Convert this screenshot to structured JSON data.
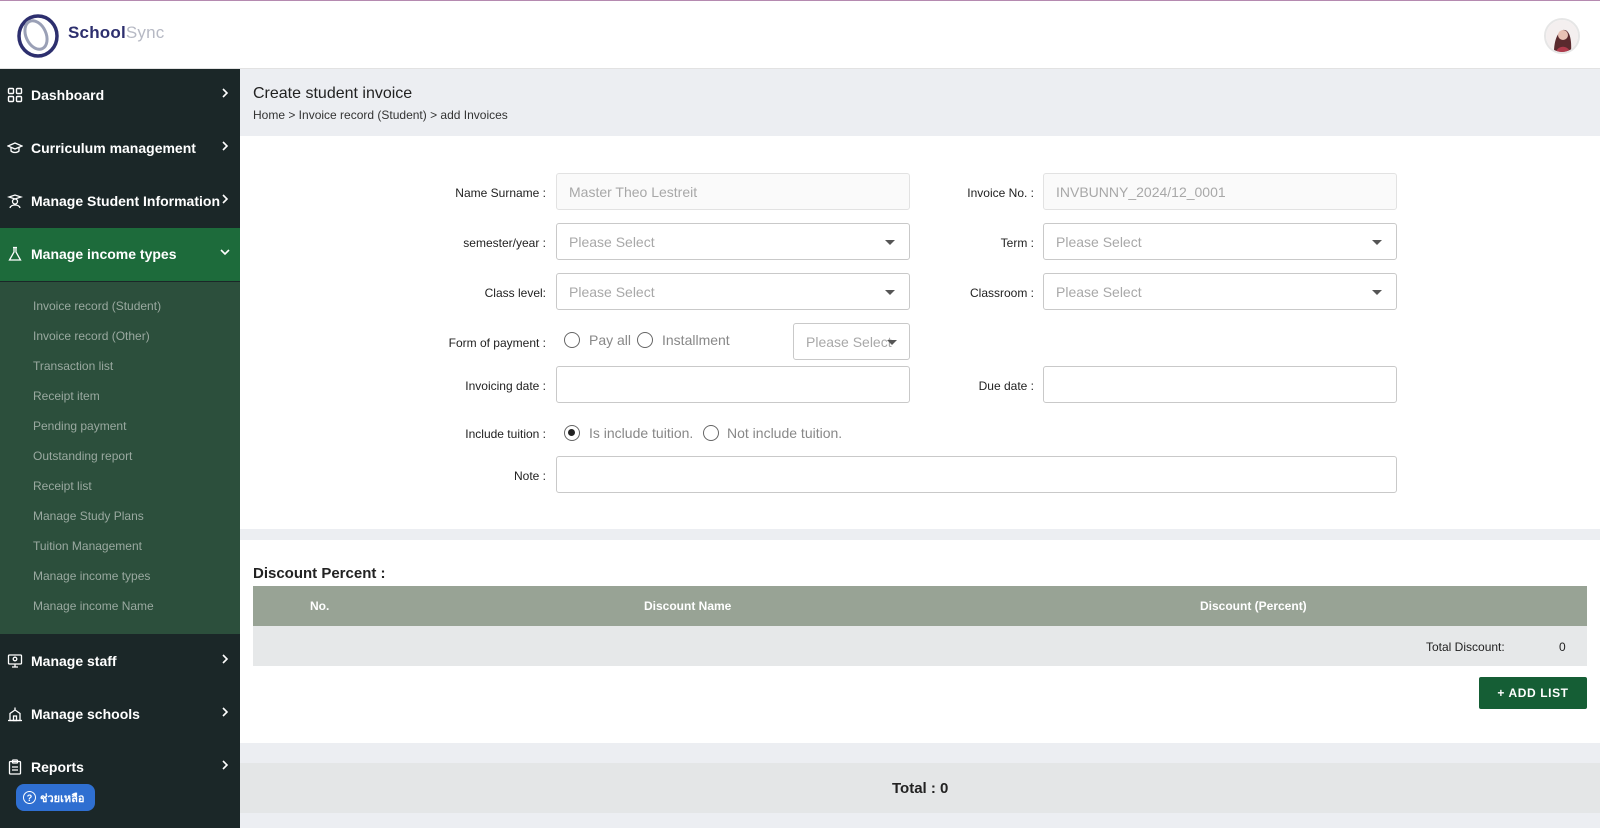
{
  "app": {
    "brand_part1": "School",
    "brand_part2": "Sync"
  },
  "sidebar": {
    "items": [
      {
        "label": "Dashboard",
        "icon": "grid-icon"
      },
      {
        "label": "Curriculum management",
        "icon": "graduation-cap-icon"
      },
      {
        "label": "Manage Student Information",
        "icon": "student-icon"
      },
      {
        "label": "Manage income types",
        "icon": "flask-icon",
        "active": true
      },
      {
        "label": "Manage staff",
        "icon": "staff-board-icon"
      },
      {
        "label": "Manage schools",
        "icon": "school-icon"
      },
      {
        "label": "Reports",
        "icon": "clipboard-icon"
      }
    ],
    "submenu": [
      "Invoice record (Student)",
      "Invoice record (Other)",
      "Transaction list",
      "Receipt item",
      "Pending payment",
      "Outstanding report",
      "Receipt list",
      "Manage Study Plans",
      "Tuition Management",
      "Manage income types",
      "Manage income Name"
    ],
    "help_label": "ช่วยเหลือ"
  },
  "page": {
    "title": "Create student invoice",
    "breadcrumb": "Home > Invoice record (Student) > add Invoices"
  },
  "form": {
    "name_label": "Name Surname :",
    "name_value": "Master Theo Lestreit",
    "invoice_no_label": "Invoice No. :",
    "invoice_no_value": "INVBUNNY_2024/12_0001",
    "semester_label": "semester/year :",
    "term_label": "Term :",
    "class_level_label": "Class level:",
    "classroom_label": "Classroom :",
    "select_placeholder": "Please Select",
    "payment_label": "Form of payment :",
    "pay_all_label": "Pay all",
    "installment_label": "Installment",
    "payment_select_placeholder": "Please Select",
    "invoicing_date_label": "Invoicing date :",
    "due_date_label": "Due date :",
    "include_tuition_label": "Include tuition :",
    "is_include_label": "Is include tuition.",
    "not_include_label": "Not include tuition.",
    "note_label": "Note :"
  },
  "discount": {
    "title": "Discount Percent :",
    "columns": [
      "No.",
      "Discount Name",
      "Discount (Percent)"
    ],
    "total_label": "Total Discount:",
    "total_value": "0",
    "add_button": "+ ADD LIST"
  },
  "total": {
    "text": "Total : 0"
  },
  "colors": {
    "sidebar_bg": "#1b2728",
    "sidebar_active": "#1d6b3b",
    "submenu_bg": "#2c4f3c",
    "table_header": "#98a395",
    "add_button": "#155e35",
    "help_button": "#2f6fd1"
  }
}
